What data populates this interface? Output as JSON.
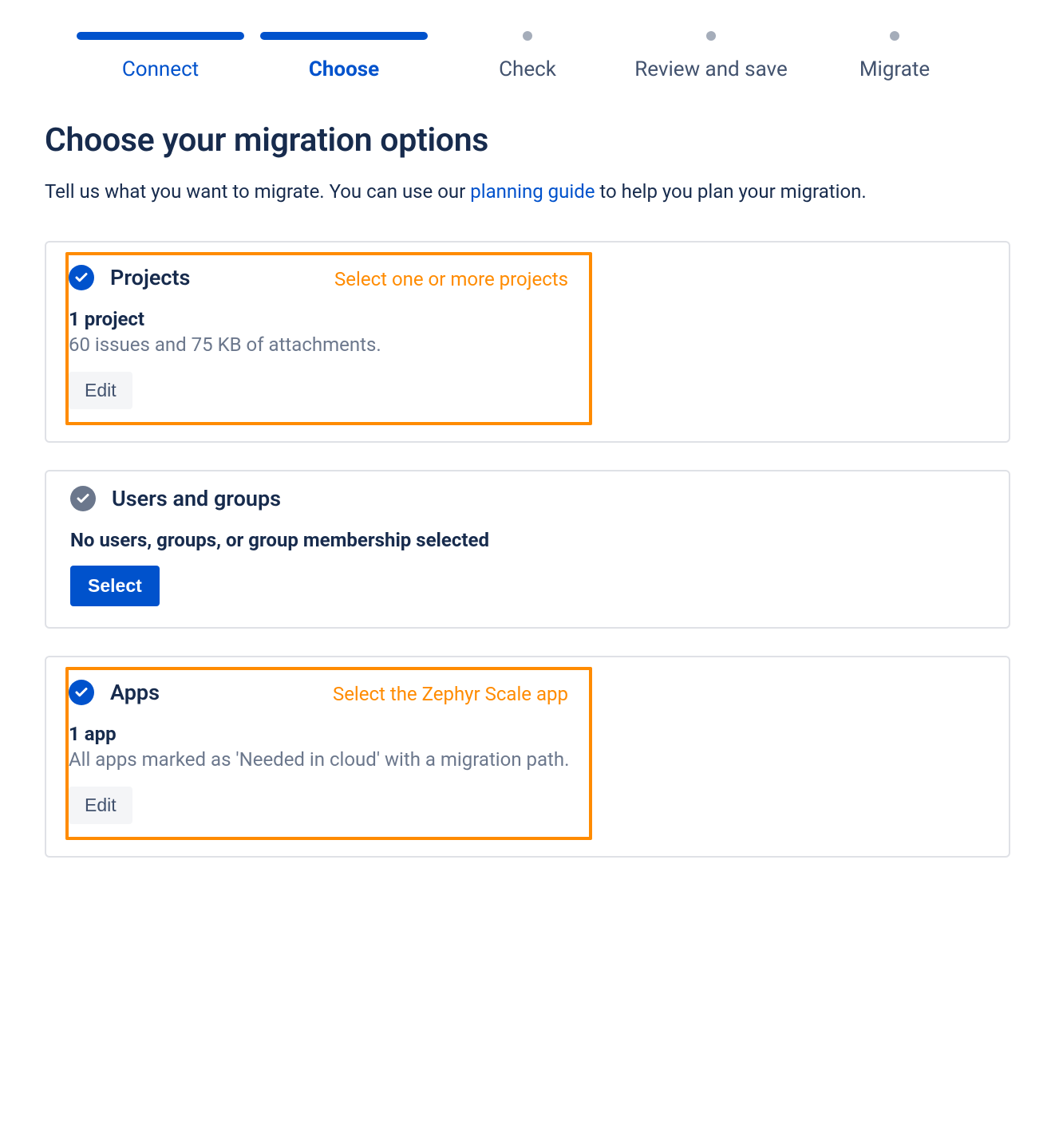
{
  "stepper": {
    "steps": [
      {
        "label": "Connect",
        "state": "done"
      },
      {
        "label": "Choose",
        "state": "active"
      },
      {
        "label": "Check",
        "state": "future"
      },
      {
        "label": "Review and save",
        "state": "future"
      },
      {
        "label": "Migrate",
        "state": "future"
      }
    ]
  },
  "heading": "Choose your migration options",
  "description_prefix": "Tell us what you want to migrate. You can use our ",
  "description_link": "planning guide",
  "description_suffix": " to help you plan your migration.",
  "cards": {
    "projects": {
      "title": "Projects",
      "annotation": "Select one or more projects",
      "line1": "1 project",
      "line2": "60 issues and 75 KB of attachments.",
      "button": "Edit"
    },
    "users": {
      "title": "Users and groups",
      "line1": "No users, groups, or group membership selected",
      "button": "Select"
    },
    "apps": {
      "title": "Apps",
      "annotation": "Select the Zephyr Scale app",
      "line1": "1 app",
      "line2": "All apps marked as 'Needed in cloud' with a migration path.",
      "button": "Edit"
    }
  }
}
